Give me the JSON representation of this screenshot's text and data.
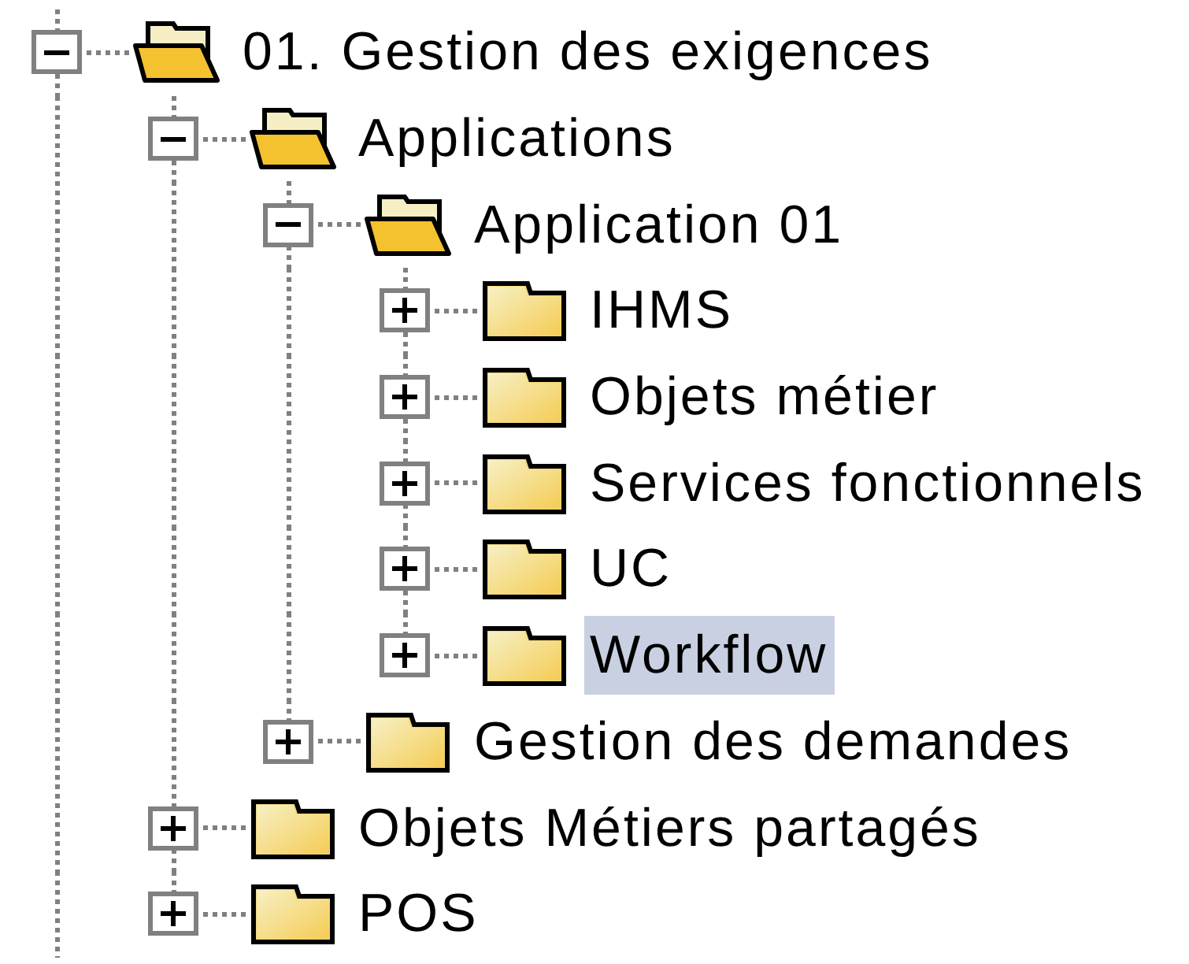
{
  "tree": [
    {
      "label": "01. Gestion des exigences",
      "expanded": true,
      "selected": false,
      "children": [
        {
          "label": "Applications",
          "expanded": true,
          "selected": false,
          "children": [
            {
              "label": "Application 01",
              "expanded": true,
              "selected": false,
              "children": [
                {
                  "label": "IHMS",
                  "expanded": false,
                  "selected": false
                },
                {
                  "label": "Objets métier",
                  "expanded": false,
                  "selected": false
                },
                {
                  "label": "Services fonctionnels",
                  "expanded": false,
                  "selected": false
                },
                {
                  "label": "UC",
                  "expanded": false,
                  "selected": false
                },
                {
                  "label": "Workflow",
                  "expanded": false,
                  "selected": true
                }
              ]
            },
            {
              "label": "Gestion des demandes",
              "expanded": false,
              "selected": false
            }
          ]
        },
        {
          "label": "Objets Métiers partagés",
          "expanded": false,
          "selected": false
        },
        {
          "label": "POS",
          "expanded": false,
          "selected": false
        }
      ]
    }
  ]
}
